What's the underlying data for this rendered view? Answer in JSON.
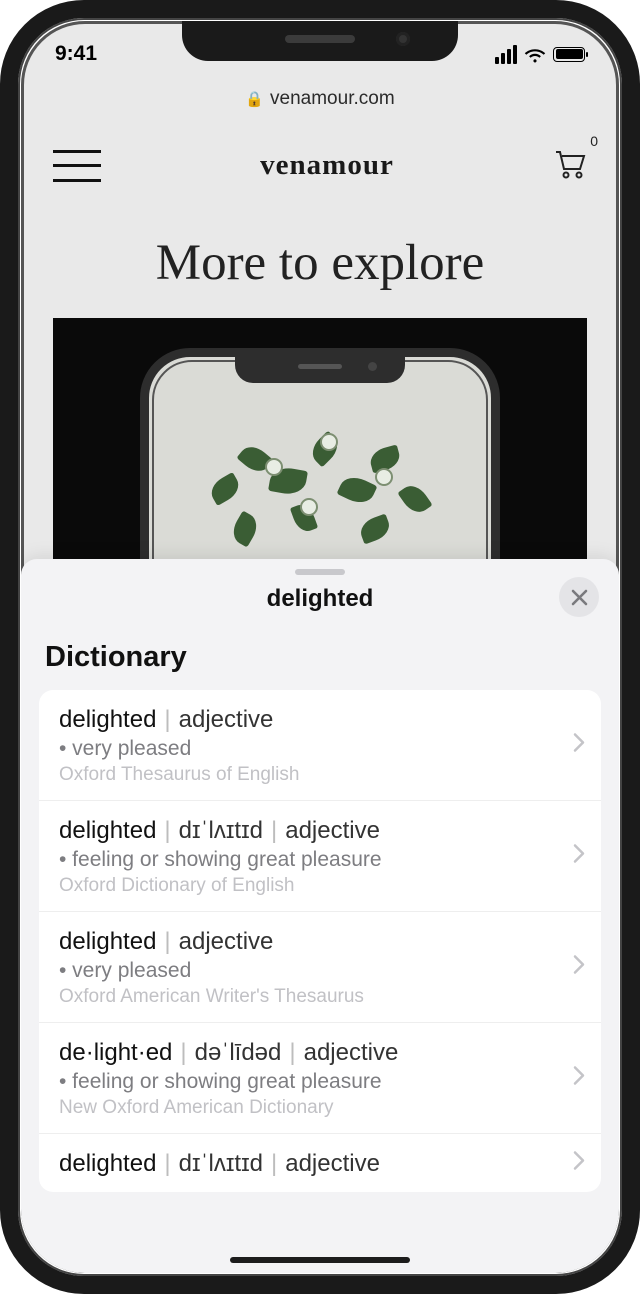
{
  "status": {
    "time": "9:41"
  },
  "browser": {
    "domain": "venamour.com"
  },
  "site": {
    "brand": "venamour",
    "cart_count": "0",
    "heading": "More to explore"
  },
  "lookup": {
    "word": "delighted",
    "section": "Dictionary",
    "entries": [
      {
        "word": "delighted",
        "pron": "",
        "pos": "adjective",
        "def": "• very pleased",
        "source": "Oxford Thesaurus of English"
      },
      {
        "word": "delighted",
        "pron": "dɪˈlʌɪtɪd",
        "pos": "adjective",
        "def": "• feeling or showing great pleasure",
        "source": "Oxford Dictionary of English"
      },
      {
        "word": "delighted",
        "pron": "",
        "pos": "adjective",
        "def": "• very pleased",
        "source": "Oxford American Writer's Thesaurus"
      },
      {
        "word": "de·light·ed",
        "pron": "dəˈlīdəd",
        "pos": "adjective",
        "def": "• feeling or showing great pleasure",
        "source": "New Oxford American Dictionary"
      },
      {
        "word": "delighted",
        "pron": "dɪˈlʌɪtɪd",
        "pos": "adjective",
        "def": "",
        "source": ""
      }
    ]
  }
}
